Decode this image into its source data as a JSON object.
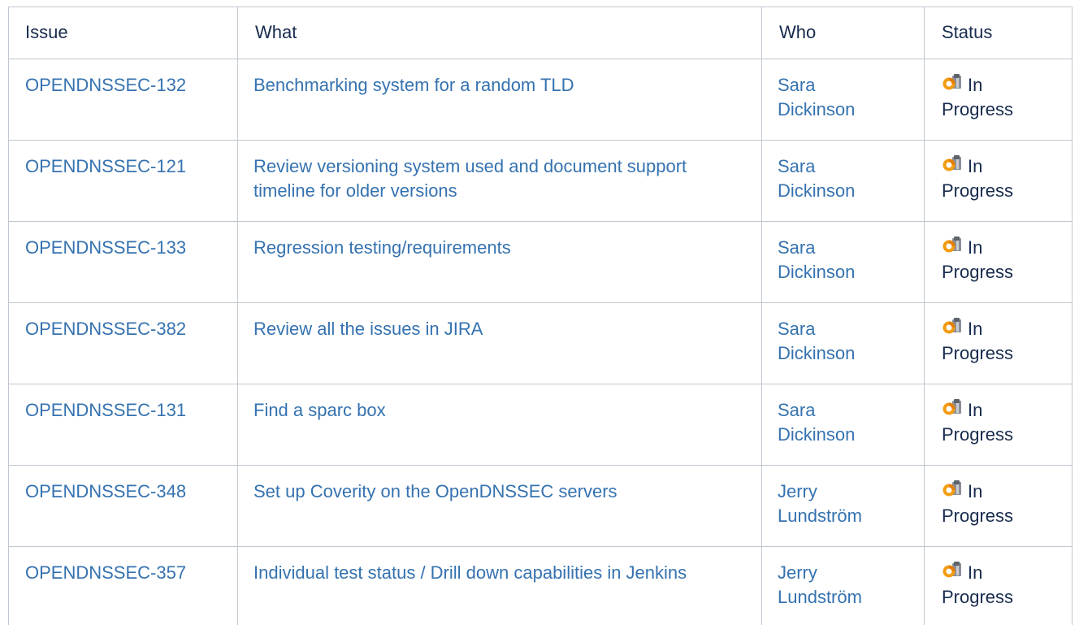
{
  "headers": {
    "issue": "Issue",
    "what": "What",
    "who": "Who",
    "status": "Status"
  },
  "rows": [
    {
      "issue": "OPENDNSSEC-132",
      "what": "Benchmarking system for a random TLD",
      "who_first": "Sara",
      "who_last": "Dickinson",
      "status_icon": "in-progress-icon",
      "status_line1": "In",
      "status_line2": "Progress"
    },
    {
      "issue": "OPENDNSSEC-121",
      "what": "Review versioning system used and document support timeline for older versions",
      "who_first": "Sara",
      "who_last": "Dickinson",
      "status_icon": "in-progress-icon",
      "status_line1": "In",
      "status_line2": "Progress"
    },
    {
      "issue": "OPENDNSSEC-133",
      "what": "Regression testing/requirements",
      "who_first": "Sara",
      "who_last": "Dickinson",
      "status_icon": "in-progress-icon",
      "status_line1": "In",
      "status_line2": "Progress"
    },
    {
      "issue": "OPENDNSSEC-382",
      "what": "Review all the issues in JIRA",
      "who_first": "Sara",
      "who_last": "Dickinson",
      "status_icon": "in-progress-icon",
      "status_line1": "In",
      "status_line2": "Progress"
    },
    {
      "issue": "OPENDNSSEC-131",
      "what": "Find a sparc box",
      "who_first": "Sara",
      "who_last": "Dickinson",
      "status_icon": "in-progress-icon",
      "status_line1": "In",
      "status_line2": "Progress"
    },
    {
      "issue": "OPENDNSSEC-348",
      "what": "Set up Coverity on the OpenDNSSEC servers",
      "who_first": "Jerry",
      "who_last": "Lundström",
      "status_icon": "in-progress-icon",
      "status_line1": "In",
      "status_line2": "Progress"
    },
    {
      "issue": "OPENDNSSEC-357",
      "what": "Individual test status / Drill down capabilities in Jenkins",
      "who_first": "Jerry",
      "who_last": "Lundström",
      "status_icon": "in-progress-icon",
      "status_line1": "In",
      "status_line2": "Progress"
    }
  ],
  "colors": {
    "link": "#3572b0",
    "text": "#172b4d",
    "border": "#c1c7d0"
  }
}
